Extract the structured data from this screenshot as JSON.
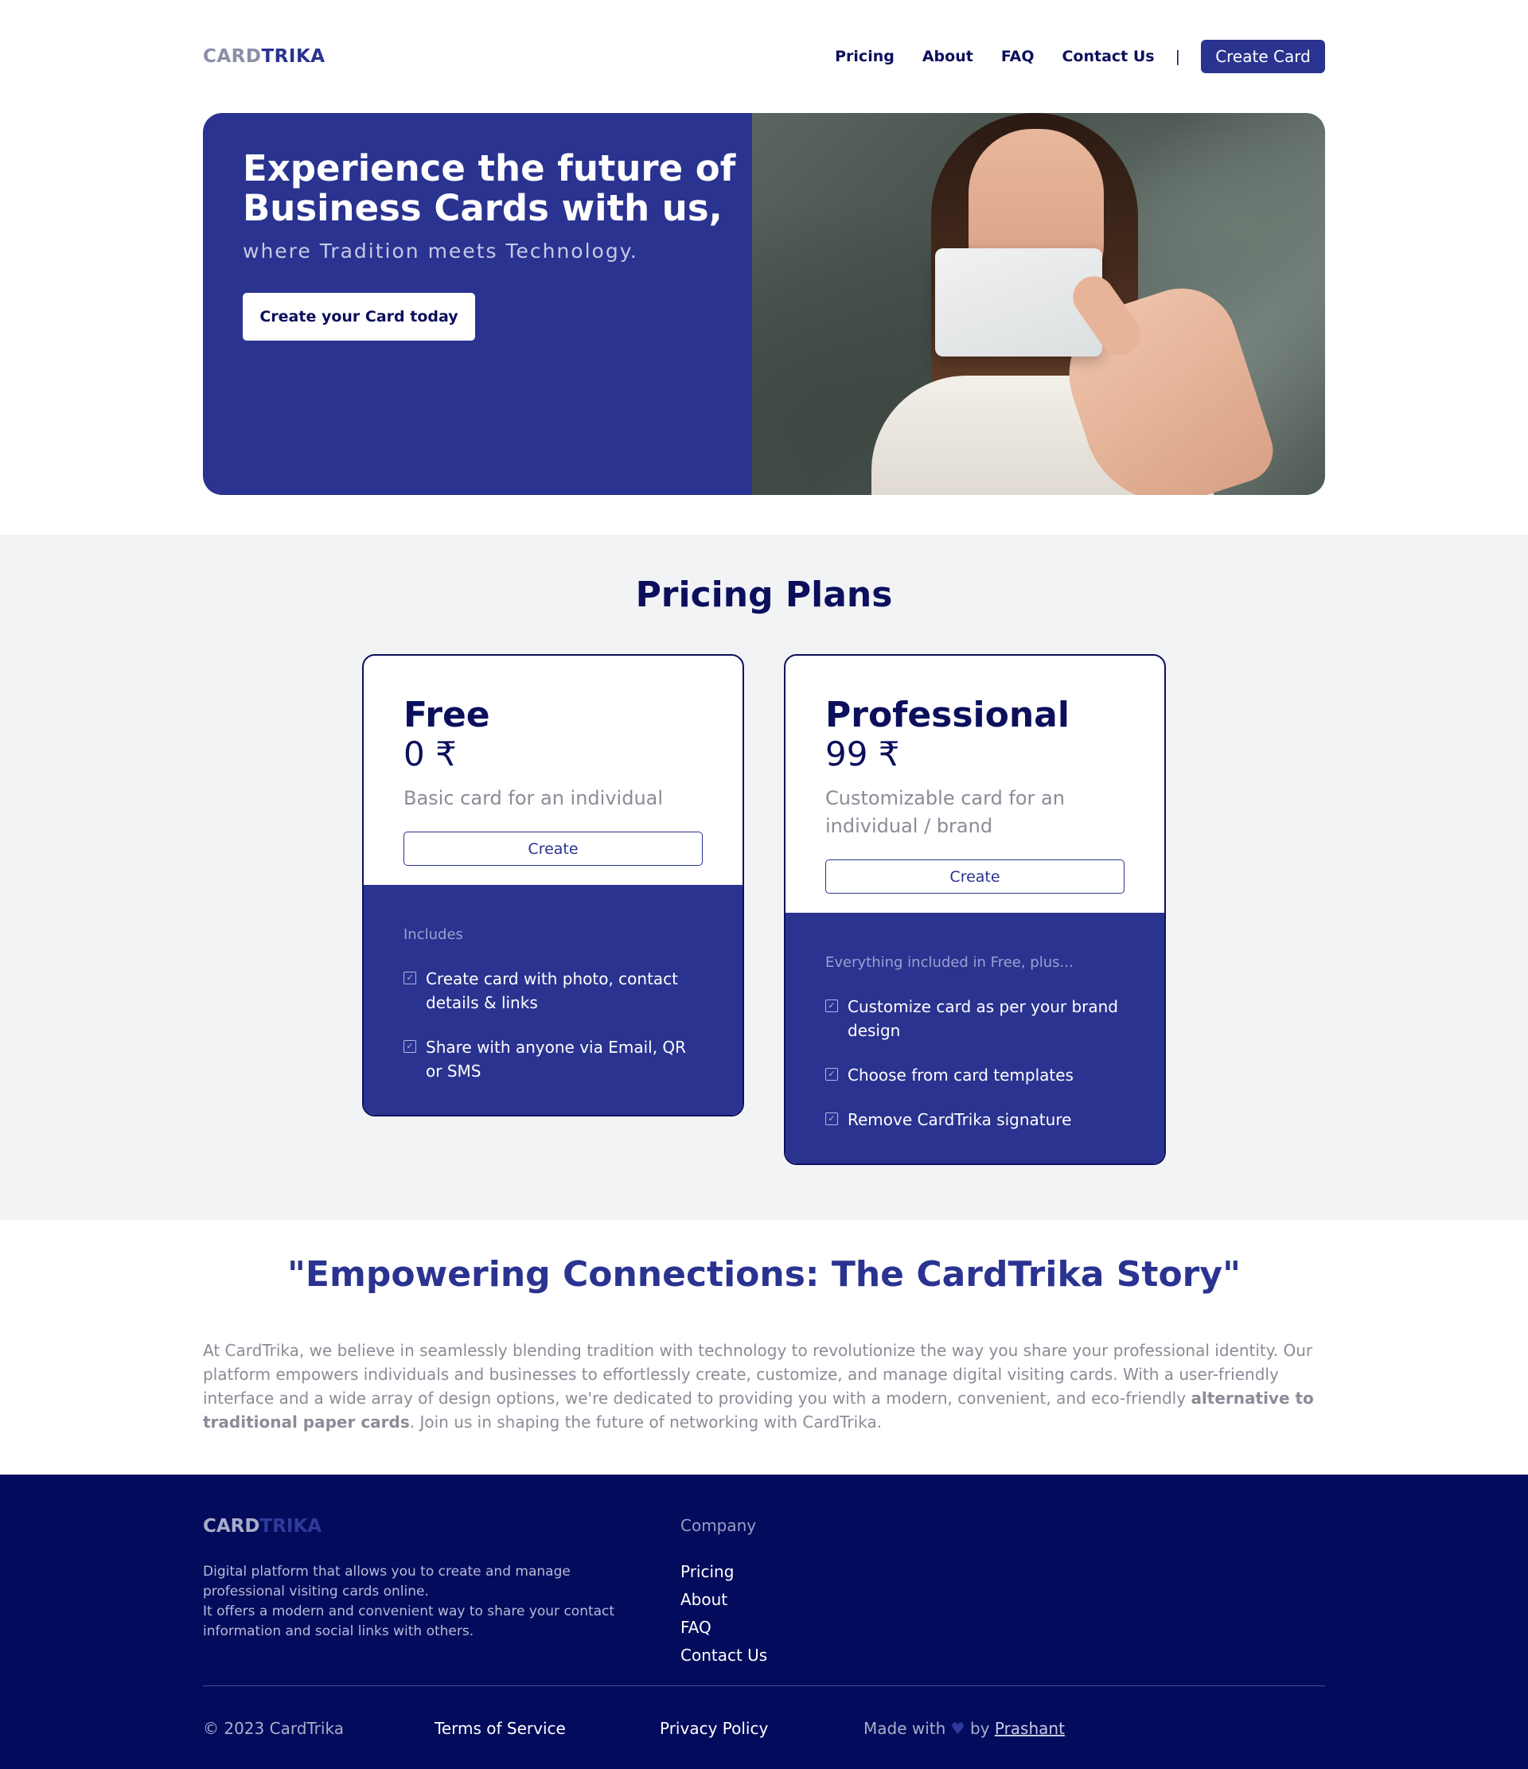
{
  "brand": {
    "part1": "CARD",
    "part2": "TRIKA",
    "color": "#2a3390"
  },
  "nav": {
    "links": [
      "Pricing",
      "About",
      "FAQ",
      "Contact Us"
    ],
    "separator": "|",
    "cta": "Create Card"
  },
  "hero": {
    "title": "Experience the future of Business Cards with us,",
    "subtitle": "where Tradition meets Technology.",
    "button": "Create your Card today"
  },
  "pricing": {
    "title": "Pricing Plans",
    "plans": [
      {
        "name": "Free",
        "price": "0 ₹",
        "description": "Basic card for an individual",
        "button": "Create",
        "features_label": "Includes",
        "features": [
          "Create card with photo, contact details & links",
          "Share with anyone via Email, QR or SMS"
        ]
      },
      {
        "name": "Professional",
        "price": "99 ₹",
        "description": "Customizable card for an individual / brand",
        "button": "Create",
        "features_label": "Everything included in Free, plus...",
        "features": [
          "Customize card as per your brand design",
          "Choose from card templates",
          "Remove CardTrika signature"
        ]
      }
    ]
  },
  "story": {
    "title": "\"Empowering Connections: The CardTrika Story\"",
    "body_pre": "At CardTrika, we believe in seamlessly blending tradition with technology to revolutionize the way you share your professional identity. Our platform empowers individuals and businesses to effortlessly create, customize, and manage digital visiting cards. With a user-friendly interface and a wide array of design options, we're dedicated to providing you with a modern, convenient, and eco-friendly ",
    "body_bold": "alternative to traditional paper cards",
    "body_post": ". Join us in shaping the future of networking with CardTrika."
  },
  "footer": {
    "description_line1": "Digital platform that allows you to create and manage professional visiting cards online.",
    "description_line2": "It offers a modern and convenient way to share your contact information and social links with others.",
    "company_label": "Company",
    "links": [
      "Pricing",
      "About",
      "FAQ",
      "Contact Us"
    ],
    "copyright": "© 2023 CardTrika",
    "terms": "Terms of Service",
    "privacy": "Privacy Policy",
    "made_with": "Made with",
    "heart": "♥",
    "by": "by",
    "author": "Prashant"
  }
}
